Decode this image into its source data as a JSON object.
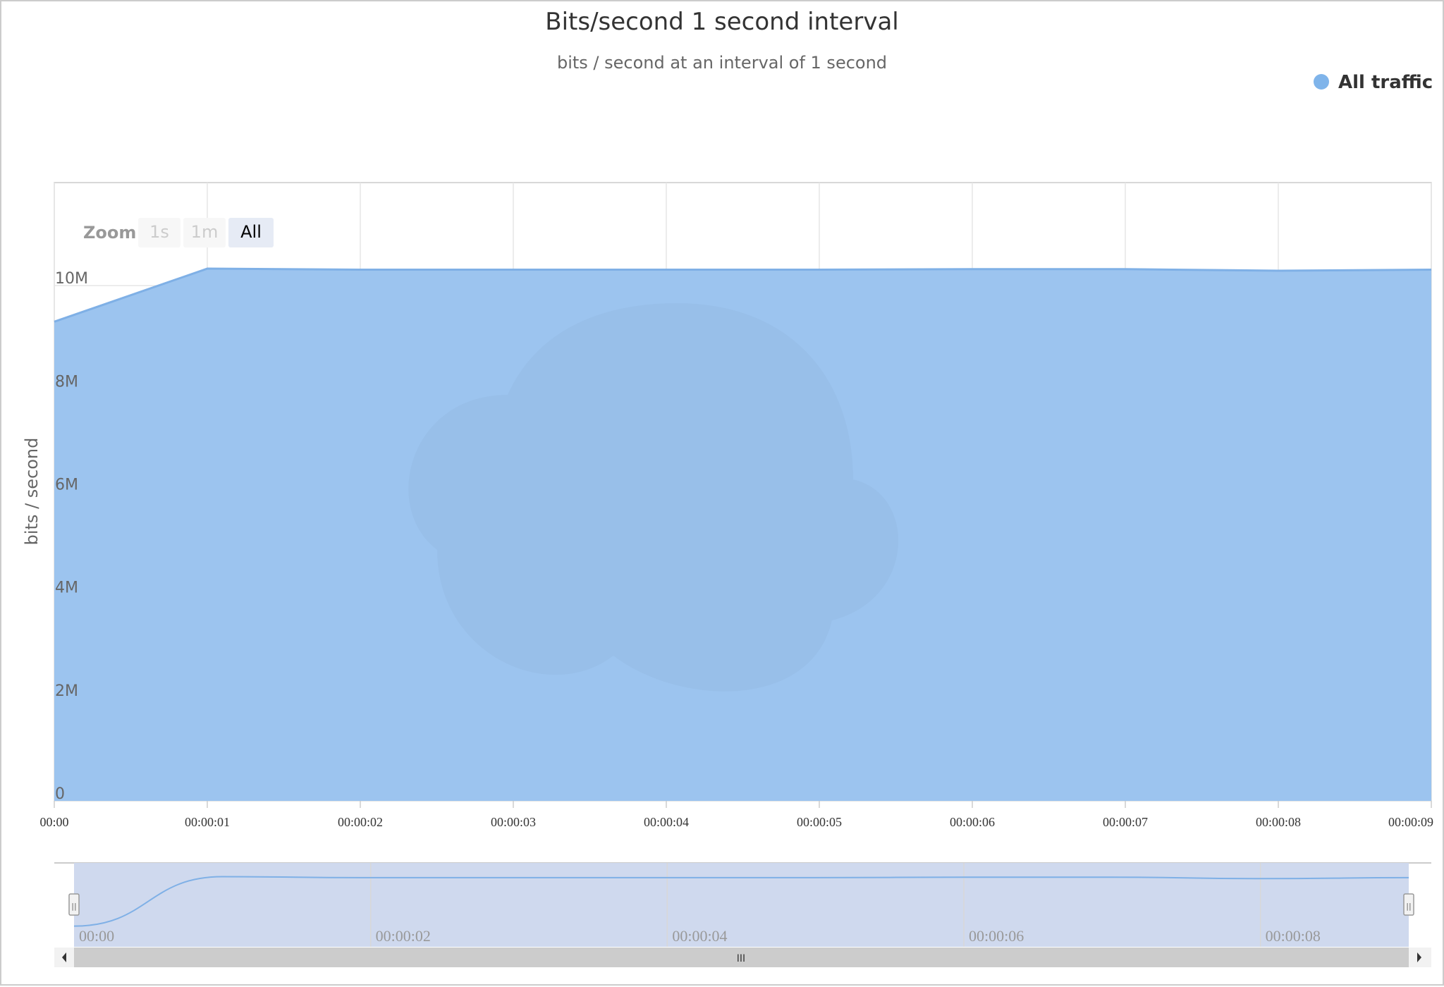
{
  "chart_data": {
    "type": "area",
    "title": "Bits/second 1 second interval",
    "subtitle": "bits / second at an interval of 1 second",
    "ylabel": "bits / second",
    "xlabel": "",
    "x": [
      "00:00",
      "00:00:01",
      "00:00:02",
      "00:00:03",
      "00:00:04",
      "00:00:05",
      "00:00:06",
      "00:00:07",
      "00:00:08",
      "00:00:09"
    ],
    "xlim": [
      0,
      9
    ],
    "ylim": [
      0,
      12000000
    ],
    "y_ticks": [
      0,
      2000000,
      4000000,
      6000000,
      8000000,
      10000000
    ],
    "y_tick_labels": [
      "0",
      "2M",
      "4M",
      "6M",
      "8M",
      "10M"
    ],
    "x_tick_labels": [
      "00:00",
      "00:00:01",
      "00:00:02",
      "00:00:03",
      "00:00:04",
      "00:00:05",
      "00:00:06",
      "00:00:07",
      "00:00:08",
      "00:00:09"
    ],
    "series": [
      {
        "name": "All traffic",
        "values": [
          9300000,
          10330000,
          10310000,
          10310000,
          10310000,
          10310000,
          10320000,
          10320000,
          10290000,
          10310000
        ]
      }
    ],
    "legend": {
      "placement": "top-right",
      "entries": [
        "All traffic"
      ]
    },
    "grid": true,
    "colors": {
      "series_fill": "#9cc4ef",
      "series_line": "#7fb0e6",
      "legend_marker": "#7fb4ea"
    },
    "zoom": {
      "label": "Zoom",
      "buttons": [
        "1s",
        "1m",
        "All"
      ],
      "selected": "All"
    },
    "navigator": {
      "tick_labels": [
        "00:00",
        "00:00:02",
        "00:00:04",
        "00:00:06",
        "00:00:08"
      ],
      "tick_values": [
        0,
        2,
        4,
        6,
        8
      ],
      "handle_glyph": "||",
      "scrollbar_grip": "III"
    }
  }
}
